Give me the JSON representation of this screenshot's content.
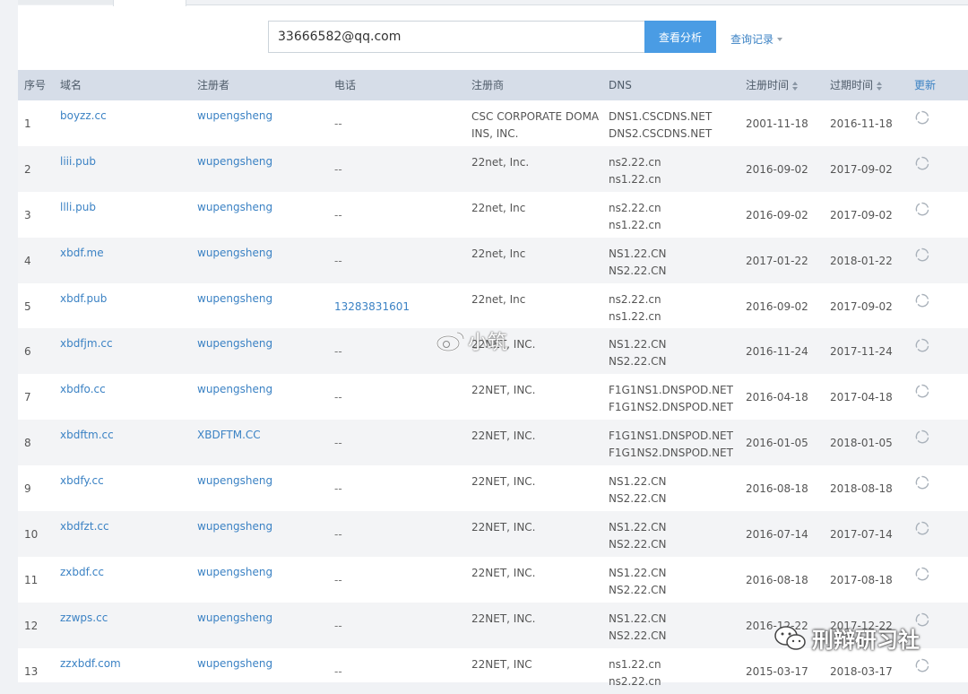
{
  "search": {
    "value": "33666582@qq.com",
    "button_label": "查看分析",
    "history_label": "查询记录"
  },
  "table": {
    "headers": {
      "idx": "序号",
      "domain": "域名",
      "registrant": "注册者",
      "phone": "电话",
      "registrar": "注册商",
      "dns": "DNS",
      "created": "注册时间",
      "expires": "过期时间",
      "update": "更新"
    },
    "rows": [
      {
        "idx": "1",
        "domain": "boyzz.cc",
        "registrant": "wupengsheng",
        "phone": "--",
        "registrar": "CSC CORPORATE DOMAINS, INC.",
        "dns1": "DNS1.CSCDNS.NET",
        "dns2": "DNS2.CSCDNS.NET",
        "created": "2001-11-18",
        "expires": "2016-11-18"
      },
      {
        "idx": "2",
        "domain": "liii.pub",
        "registrant": "wupengsheng",
        "phone": "--",
        "registrar": "22net, Inc.",
        "dns1": "ns2.22.cn",
        "dns2": "ns1.22.cn",
        "created": "2016-09-02",
        "expires": "2017-09-02"
      },
      {
        "idx": "3",
        "domain": "llli.pub",
        "registrant": "wupengsheng",
        "phone": "--",
        "registrar": "22net, Inc",
        "dns1": "ns2.22.cn",
        "dns2": "ns1.22.cn",
        "created": "2016-09-02",
        "expires": "2017-09-02"
      },
      {
        "idx": "4",
        "domain": "xbdf.me",
        "registrant": "wupengsheng",
        "phone": "--",
        "registrar": "22net, Inc",
        "dns1": "NS1.22.CN",
        "dns2": "NS2.22.CN",
        "created": "2017-01-22",
        "expires": "2018-01-22"
      },
      {
        "idx": "5",
        "domain": "xbdf.pub",
        "registrant": "wupengsheng",
        "phone": "13283831601",
        "registrar": "22net, Inc",
        "dns1": "ns2.22.cn",
        "dns2": "ns1.22.cn",
        "created": "2016-09-02",
        "expires": "2017-09-02"
      },
      {
        "idx": "6",
        "domain": "xbdfjm.cc",
        "registrant": "wupengsheng",
        "phone": "--",
        "registrar": "22NET, INC.",
        "dns1": "NS1.22.CN",
        "dns2": "NS2.22.CN",
        "created": "2016-11-24",
        "expires": "2017-11-24"
      },
      {
        "idx": "7",
        "domain": "xbdfo.cc",
        "registrant": "wupengsheng",
        "phone": "--",
        "registrar": "22NET, INC.",
        "dns1": "F1G1NS1.DNSPOD.NET",
        "dns2": "F1G1NS2.DNSPOD.NET",
        "created": "2016-04-18",
        "expires": "2017-04-18"
      },
      {
        "idx": "8",
        "domain": "xbdftm.cc",
        "registrant": "XBDFTM.CC",
        "phone": "--",
        "registrar": "22NET, INC.",
        "dns1": "F1G1NS1.DNSPOD.NET",
        "dns2": "F1G1NS2.DNSPOD.NET",
        "created": "2016-01-05",
        "expires": "2018-01-05"
      },
      {
        "idx": "9",
        "domain": "xbdfy.cc",
        "registrant": "wupengsheng",
        "phone": "--",
        "registrar": "22NET, INC.",
        "dns1": "NS1.22.CN",
        "dns2": "NS2.22.CN",
        "created": "2016-08-18",
        "expires": "2018-08-18"
      },
      {
        "idx": "10",
        "domain": "xbdfzt.cc",
        "registrant": "wupengsheng",
        "phone": "--",
        "registrar": "22NET, INC.",
        "dns1": "NS1.22.CN",
        "dns2": "NS2.22.CN",
        "created": "2016-07-14",
        "expires": "2017-07-14"
      },
      {
        "idx": "11",
        "domain": "zxbdf.cc",
        "registrant": "wupengsheng",
        "phone": "--",
        "registrar": "22NET, INC.",
        "dns1": "NS1.22.CN",
        "dns2": "NS2.22.CN",
        "created": "2016-08-18",
        "expires": "2017-08-18"
      },
      {
        "idx": "12",
        "domain": "zzwps.cc",
        "registrant": "wupengsheng",
        "phone": "--",
        "registrar": "22NET, INC.",
        "dns1": "NS1.22.CN",
        "dns2": "NS2.22.CN",
        "created": "2016-12-22",
        "expires": "2017-12-22"
      },
      {
        "idx": "13",
        "domain": "zzxbdf.com",
        "registrant": "wupengsheng",
        "phone": "--",
        "registrar": "22NET, INC",
        "dns1": "ns1.22.cn",
        "dns2": "ns2.22.cn",
        "created": "2015-03-17",
        "expires": "2018-03-17"
      }
    ]
  },
  "watermarks": {
    "weibo_text": "小筑",
    "wechat_text": "刑辩研习社"
  },
  "icons": {
    "refresh": "refresh-icon",
    "sort": "sort-icon",
    "dropdown": "chevron-down-icon",
    "weibo": "weibo-icon",
    "wechat": "wechat-icon"
  }
}
